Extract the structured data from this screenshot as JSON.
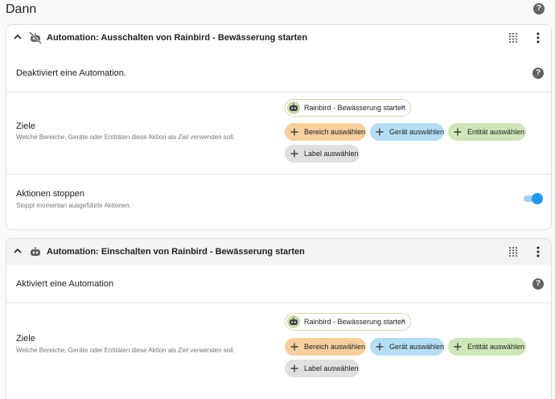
{
  "section": {
    "title": "Dann"
  },
  "cards": [
    {
      "title": "Automation: Ausschalten von Rainbird - Bewässerung starten",
      "icon": "robot-off-icon",
      "description": "Deaktiviert eine Automation.",
      "targets": {
        "label": "Ziele",
        "help": "Welche Bereiche, Geräte oder Entitäten diese Aktion als Ziel verwenden soll.",
        "selected": "Rainbird - Bewässerung starten",
        "area_button": "Bereich auswählen",
        "device_button": "Gerät auswählen",
        "entity_button": "Entität auswählen",
        "label_button": "Label auswählen"
      },
      "stop_actions": {
        "label": "Aktionen stoppen",
        "help": "Stoppt momentan ausgeführte Aktionen.",
        "enabled": true
      }
    },
    {
      "title": "Automation: Einschalten von Rainbird - Bewässerung starten",
      "icon": "robot-icon",
      "description": "Aktiviert eine Automation",
      "targets": {
        "label": "Ziele",
        "help": "Welche Bereiche, Geräte oder Entitäten diese Aktion als Ziel verwenden soll.",
        "selected": "Rainbird - Bewässerung starten",
        "area_button": "Bereich auswählen",
        "device_button": "Gerät auswählen",
        "entity_button": "Entität auswählen",
        "label_button": "Label auswählen"
      }
    }
  ],
  "icons": {
    "help": "?",
    "remove": "×"
  },
  "colors": {
    "area": "#f7cf9e",
    "device": "#b3def5",
    "entity": "#cfe7b8",
    "label": "#e0e0e0",
    "toggle": "#2196f3"
  }
}
